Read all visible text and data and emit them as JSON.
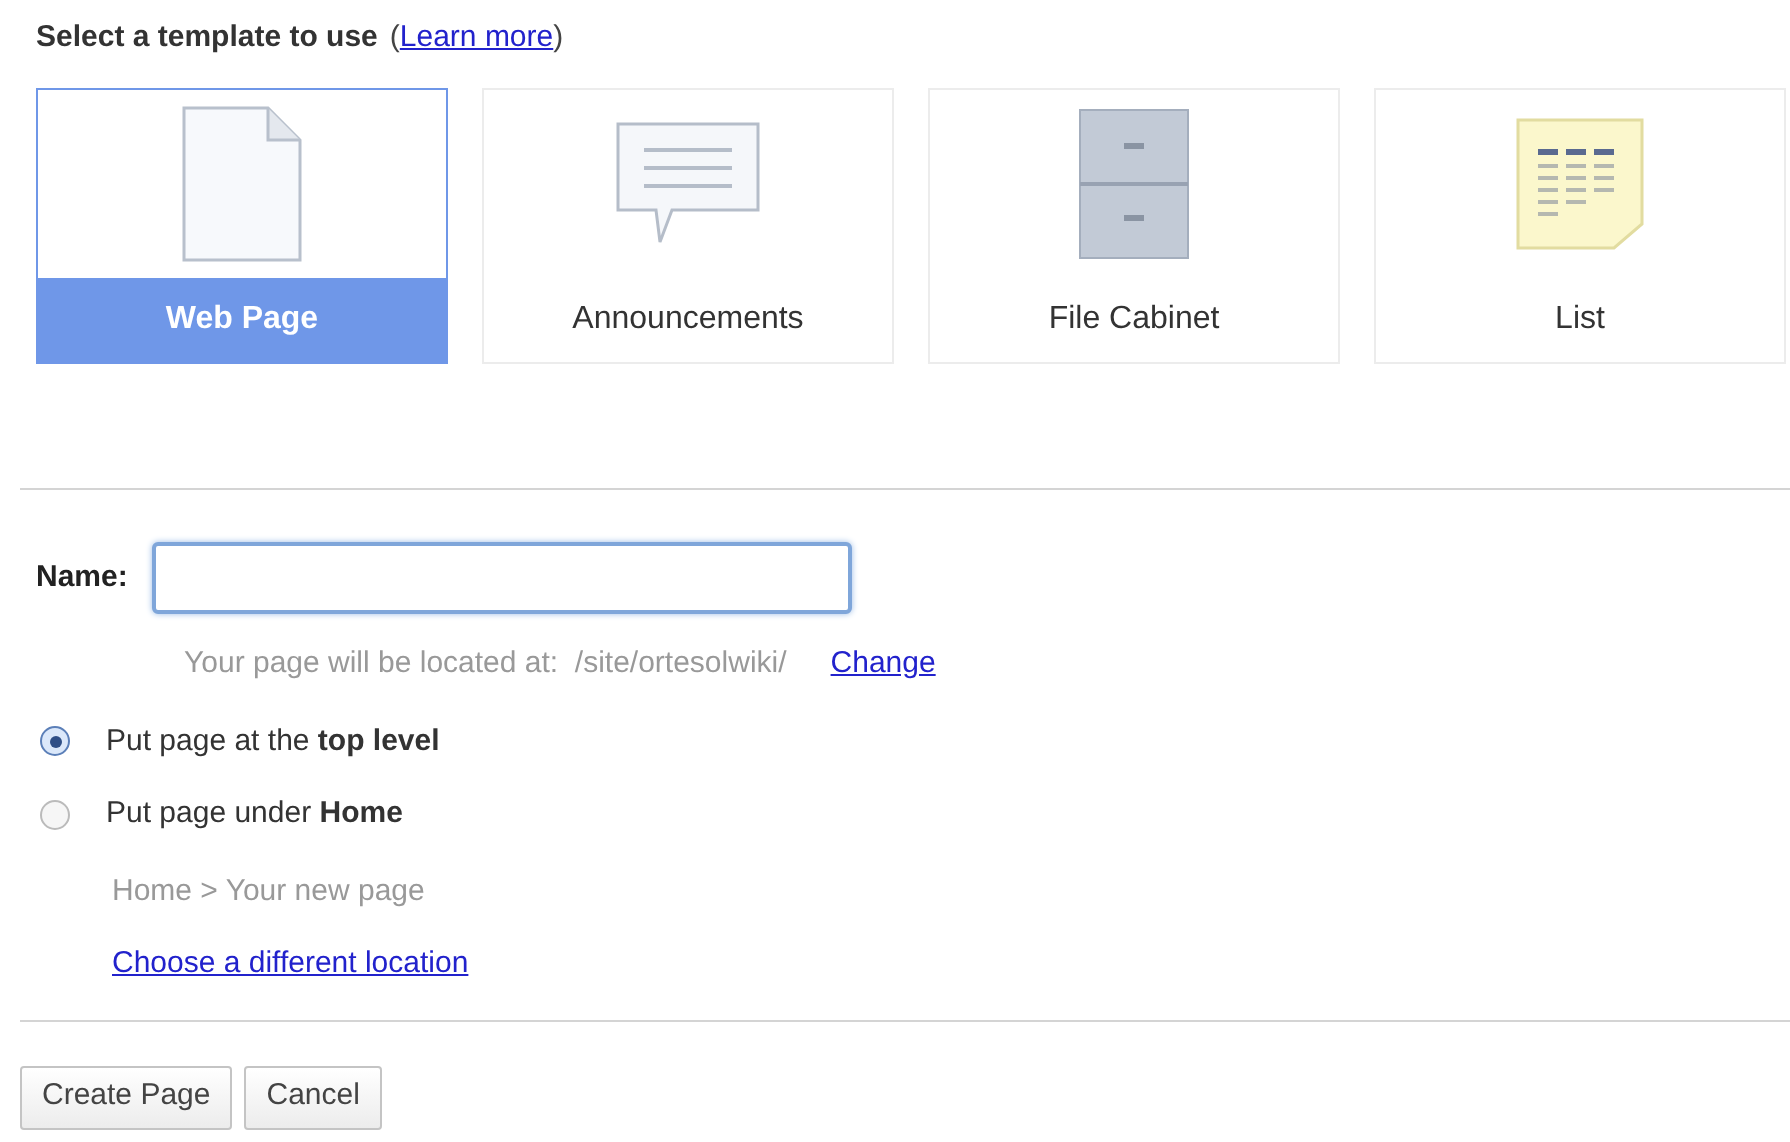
{
  "heading": "Select a template to use",
  "learn_more": {
    "open": "(",
    "link": "Learn more",
    "close": ")"
  },
  "templates": [
    {
      "kind": "page",
      "label": "Web Page",
      "selected": true
    },
    {
      "kind": "announcement",
      "label": "Announcements",
      "selected": false
    },
    {
      "kind": "cabinet",
      "label": "File Cabinet",
      "selected": false
    },
    {
      "kind": "list",
      "label": "List",
      "selected": false
    }
  ],
  "name_field": {
    "label": "Name:"
  },
  "location": {
    "text": "Your page will be located at:  /site/ortesolwiki/",
    "link": "Change"
  },
  "placement": [
    {
      "label": "Put page at the **top level**",
      "selected": true
    },
    {
      "label": "Put page under **Home**",
      "selected": false
    }
  ],
  "breadcrumb": "Home > Your new page",
  "choose_link": "Choose a different location",
  "buttons": [
    "Create Page",
    "Cancel"
  ]
}
